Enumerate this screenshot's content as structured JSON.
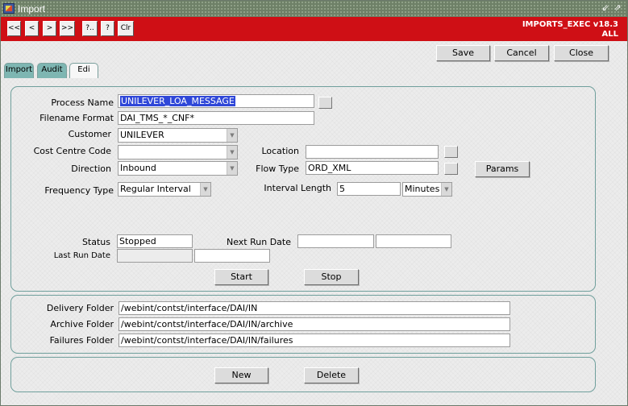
{
  "window": {
    "title": "Import",
    "minimize_glyph": "⇙",
    "maximize_glyph": "⇗"
  },
  "toolbar": {
    "buttons": [
      "<<",
      "<",
      ">",
      ">>",
      "?..",
      "?",
      "Clr"
    ],
    "app_name": "IMPORTS_EXEC v18.3",
    "app_scope": "ALL"
  },
  "actions": {
    "save": "Save",
    "cancel": "Cancel",
    "close": "Close"
  },
  "tabs": [
    {
      "label": "Import",
      "active": true
    },
    {
      "label": "Audit",
      "active": true
    },
    {
      "label": "Edi",
      "active": false
    }
  ],
  "form": {
    "process_name": {
      "label": "Process Name",
      "value": "UNILEVER_LOA_MESSAGE"
    },
    "filename_format": {
      "label": "Filename Format",
      "value": "DAI_TMS_*_CNF*"
    },
    "customer": {
      "label": "Customer",
      "value": "UNILEVER"
    },
    "cost_centre_code": {
      "label": "Cost Centre Code",
      "value": ""
    },
    "location": {
      "label": "Location",
      "value": ""
    },
    "direction": {
      "label": "Direction",
      "value": "Inbound"
    },
    "flow_type": {
      "label": "Flow Type",
      "value": "ORD_XML"
    },
    "params_button": "Params",
    "frequency_type": {
      "label": "Frequency Type",
      "value": "Regular Interval"
    },
    "interval_length": {
      "label": "Interval Length",
      "value": "5",
      "unit": "Minutes"
    },
    "status": {
      "label": "Status",
      "value": "Stopped"
    },
    "next_run_date": {
      "label": "Next Run Date",
      "value": ""
    },
    "last_run_date": {
      "label": "Last Run Date",
      "value": ""
    },
    "start_button": "Start",
    "stop_button": "Stop"
  },
  "folders": {
    "delivery": {
      "label": "Delivery Folder",
      "value": "/webint/contst/interface/DAI/IN"
    },
    "archive": {
      "label": "Archive Folder",
      "value": "/webint/contst/interface/DAI/IN/archive"
    },
    "failures": {
      "label": "Failures Folder",
      "value": "/webint/contst/interface/DAI/IN/failures"
    }
  },
  "footer": {
    "new": "New",
    "delete": "Delete"
  },
  "icons": {
    "app": "oracle-forms-app-icon",
    "dropdown": "▼"
  },
  "colors": {
    "toolbar_bg": "#cf0f15",
    "titlebar_bg": "#6e8067",
    "tab_active": "#7eb6b2",
    "selection": "#2f47d8",
    "panel_border": "#6f9f9c"
  }
}
